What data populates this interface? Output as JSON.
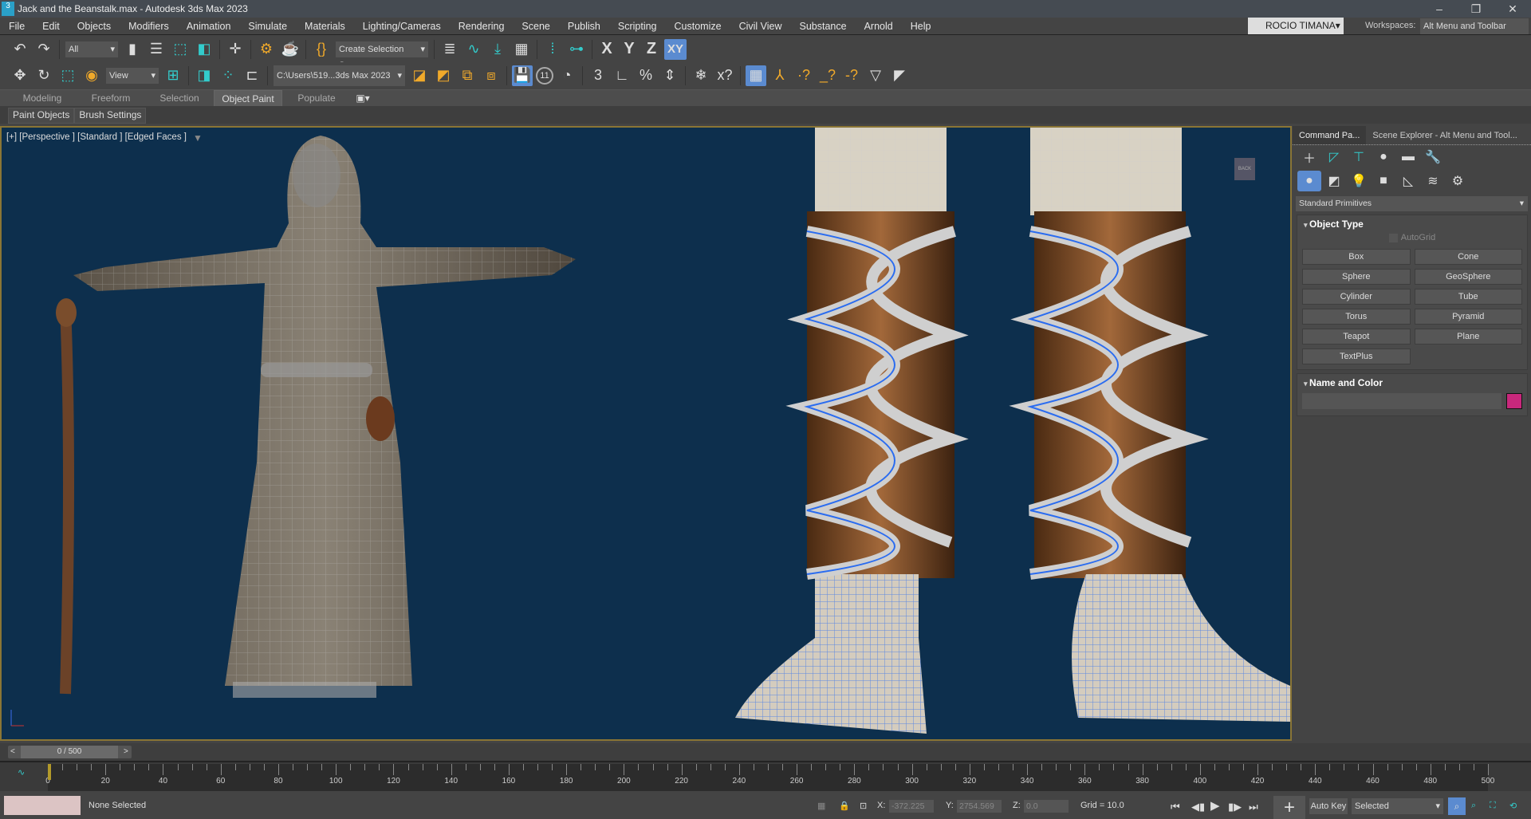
{
  "window": {
    "title": "Jack and the Beanstalk.max - Autodesk 3ds Max 2023",
    "app_icon": "3"
  },
  "menu": [
    "File",
    "Edit",
    "Objects",
    "Modifiers",
    "Animation",
    "Simulate",
    "Materials",
    "Lighting/Cameras",
    "Rendering",
    "Scene",
    "Publish",
    "Scripting",
    "Customize",
    "Civil View",
    "Substance",
    "Arnold",
    "Help"
  ],
  "user": "ROCIO TIMANA▾",
  "workspaces": {
    "label": "Workspaces:",
    "value": "Alt Menu and Toolbar"
  },
  "toolbar": {
    "filter": "All",
    "selection_set": "Create Selection Se",
    "ref_coord": "View",
    "project_path": "C:\\Users\\519...3ds Max 2023",
    "axes": [
      "X",
      "Y",
      "Z",
      "XY"
    ],
    "frame_badge": "11",
    "snap_3": "3"
  },
  "ribbon": {
    "tabs": [
      "Modeling",
      "Freeform",
      "Selection",
      "Object Paint",
      "Populate"
    ],
    "active": "Object Paint",
    "subtabs": [
      "Paint Objects",
      "Brush Settings"
    ]
  },
  "viewport": {
    "label": "[+] [Perspective ] [Standard ] [Edged Faces ]",
    "viewcube": "BACK"
  },
  "panel": {
    "tabs": [
      "Command Pa...",
      "Scene Explorer - Alt Menu and Tool..."
    ],
    "category": "Standard Primitives",
    "object_type": {
      "title": "Object Type",
      "autogrid": "AutoGrid",
      "buttons": [
        "Box",
        "Cone",
        "Sphere",
        "GeoSphere",
        "Cylinder",
        "Tube",
        "Torus",
        "Pyramid",
        "Teapot",
        "Plane",
        "TextPlus"
      ]
    },
    "name_color": {
      "title": "Name and Color",
      "color": "#c8287c"
    }
  },
  "timeline": {
    "frame": "0 / 500",
    "ticks": [
      "0",
      "20",
      "40",
      "60",
      "80",
      "100",
      "120",
      "140",
      "160",
      "180",
      "200",
      "220",
      "240",
      "260",
      "280",
      "300",
      "320",
      "340",
      "360",
      "380",
      "400",
      "420",
      "440",
      "460",
      "480",
      "500"
    ]
  },
  "status": {
    "selection": "None Selected",
    "x_label": "X:",
    "x": "-372.225",
    "y_label": "Y:",
    "y": "2754.569",
    "z_label": "Z:",
    "z": "0.0",
    "grid": "Grid = 10.0",
    "autokey": "Auto Key",
    "key_mode": "Selected"
  }
}
